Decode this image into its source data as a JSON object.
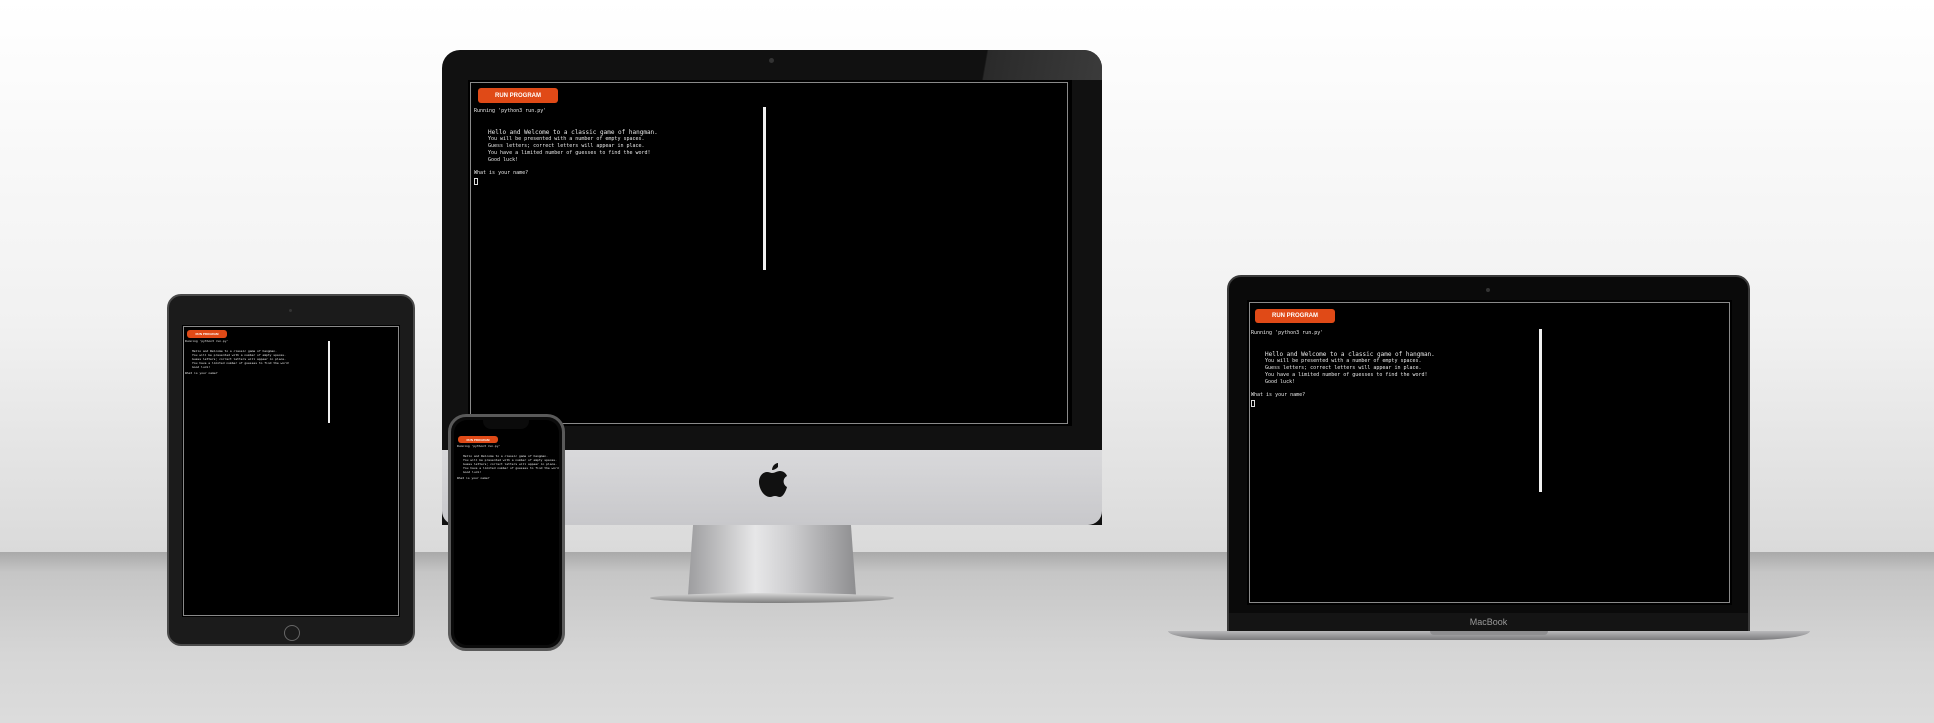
{
  "terminal": {
    "run_button": "RUN PROGRAM",
    "status_line": "Running 'python3 run.py'",
    "intro_lines": [
      "Hello and Welcome to a classic game of hangman.",
      "You will be presented with a number of empty spaces.",
      "Guess letters; correct letters will appear in place.",
      "You have a limited number of guesses to find the word!",
      "Good luck!"
    ],
    "prompt": "What is your name?"
  },
  "devices": {
    "laptop_brand": "MacBook"
  },
  "colors": {
    "run_button": "#e04a17",
    "terminal_bg": "#000000",
    "terminal_text": "#e8e8e8"
  }
}
